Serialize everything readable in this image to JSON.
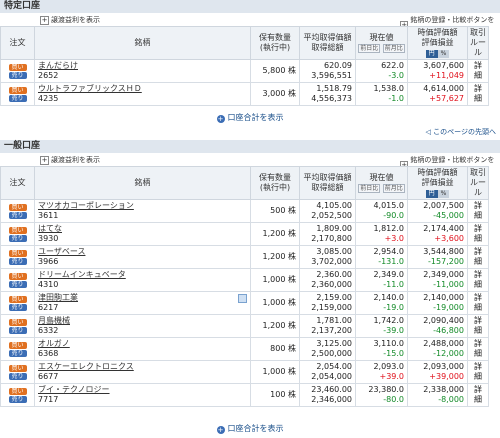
{
  "tokutei": {
    "title": "特定口座",
    "show_fee_label": "譲渡益利を表示",
    "register_label": "銘柄の登録・比較ボタンを表示",
    "total_link": "口座合計を表示",
    "rows": [
      {
        "name": "まんだらけ",
        "code": "2652",
        "qty": "5,800",
        "qty_unit": "株",
        "avg": "620.09",
        "avg_total": "3,596,551",
        "price": "622.0",
        "change": "-3.0",
        "change_dir": "neg",
        "value": "3,607,600",
        "pl": "+11,049",
        "pl_dir": "pos",
        "detail": "詳細"
      },
      {
        "name": "ウルトラファブリックスＨＤ",
        "code": "4235",
        "qty": "3,000",
        "qty_unit": "株",
        "avg": "1,518.79",
        "avg_total": "4,556,373",
        "price": "1,538.0",
        "change": "-1.0",
        "change_dir": "neg",
        "value": "4,614,000",
        "pl": "+57,627",
        "pl_dir": "pos",
        "detail": "詳細"
      }
    ]
  },
  "ippan": {
    "title": "一般口座",
    "show_fee_label": "譲渡益利を表示",
    "register_label": "銘柄の登録・比較ボタンを表示",
    "total_link": "口座合計を表示",
    "rows": [
      {
        "name": "マツオカコーポレーション",
        "code": "3611",
        "qty": "500",
        "qty_unit": "株",
        "avg": "4,105.00",
        "avg_total": "2,052,500",
        "price": "4,015.0",
        "change": "-90.0",
        "change_dir": "neg",
        "value": "2,007,500",
        "pl": "-45,000",
        "pl_dir": "neg",
        "detail": "詳細"
      },
      {
        "name": "はてな",
        "code": "3930",
        "qty": "1,200",
        "qty_unit": "株",
        "avg": "1,809.00",
        "avg_total": "2,170,800",
        "price": "1,812.0",
        "change": "+3.0",
        "change_dir": "pos",
        "value": "2,174,400",
        "pl": "+3,600",
        "pl_dir": "pos",
        "detail": "詳細"
      },
      {
        "name": "ユーザベース",
        "code": "3966",
        "qty": "1,200",
        "qty_unit": "株",
        "avg": "3,085.00",
        "avg_total": "3,702,000",
        "price": "2,954.0",
        "change": "-131.0",
        "change_dir": "neg",
        "value": "3,544,800",
        "pl": "-157,200",
        "pl_dir": "neg",
        "detail": "詳細"
      },
      {
        "name": "ドリームインキュベータ",
        "code": "4310",
        "qty": "1,000",
        "qty_unit": "株",
        "avg": "2,360.00",
        "avg_total": "2,360,000",
        "price": "2,349.0",
        "change": "-11.0",
        "change_dir": "neg",
        "value": "2,349,000",
        "pl": "-11,000",
        "pl_dir": "neg",
        "detail": "詳細"
      },
      {
        "name": "津田駒工業",
        "code": "6217",
        "qty": "1,000",
        "qty_unit": "株",
        "avg": "2,159.00",
        "avg_total": "2,159,000",
        "price": "2,140.0",
        "change": "-19.0",
        "change_dir": "neg",
        "value": "2,140,000",
        "pl": "-19,000",
        "pl_dir": "neg",
        "detail": "詳細",
        "memo": true
      },
      {
        "name": "月島機械",
        "code": "6332",
        "qty": "1,200",
        "qty_unit": "株",
        "avg": "1,781.00",
        "avg_total": "2,137,200",
        "price": "1,742.0",
        "change": "-39.0",
        "change_dir": "neg",
        "value": "2,090,400",
        "pl": "-46,800",
        "pl_dir": "neg",
        "detail": "詳細"
      },
      {
        "name": "オルガノ",
        "code": "6368",
        "qty": "800",
        "qty_unit": "株",
        "avg": "3,125.00",
        "avg_total": "2,500,000",
        "price": "3,110.0",
        "change": "-15.0",
        "change_dir": "neg",
        "value": "2,488,000",
        "pl": "-12,000",
        "pl_dir": "neg",
        "detail": "詳細"
      },
      {
        "name": "エスケーエレクトロニクス",
        "code": "6677",
        "qty": "1,000",
        "qty_unit": "株",
        "avg": "2,054.00",
        "avg_total": "2,054,000",
        "price": "2,093.0",
        "change": "+39.0",
        "change_dir": "pos",
        "value": "2,093,000",
        "pl": "+39,000",
        "pl_dir": "pos",
        "detail": "詳細"
      },
      {
        "name": "ブイ・テクノロジー",
        "code": "7717",
        "qty": "100",
        "qty_unit": "株",
        "avg": "23,460.00",
        "avg_total": "2,346,000",
        "price": "23,380.0",
        "change": "-80.0",
        "change_dir": "neg",
        "value": "2,338,000",
        "pl": "-8,000",
        "pl_dir": "neg",
        "detail": "詳細"
      }
    ]
  },
  "headers": {
    "order": "注文",
    "name": "銘柄",
    "qty1": "保有数量",
    "qty2": "(執行中)",
    "avg1": "平均取得価額",
    "avg2": "取得総額",
    "price1": "現在値",
    "price_btn1": "前日比",
    "price_btn2": "前月比",
    "val1": "時価評価額",
    "val2": "評価損益",
    "tog_yen": "円",
    "tog_pct": "%",
    "trade1": "取引",
    "trade2": "ルール"
  },
  "badges": {
    "buy": "買い",
    "sell": "売り"
  },
  "page_top_link": "このページの先頭へ"
}
